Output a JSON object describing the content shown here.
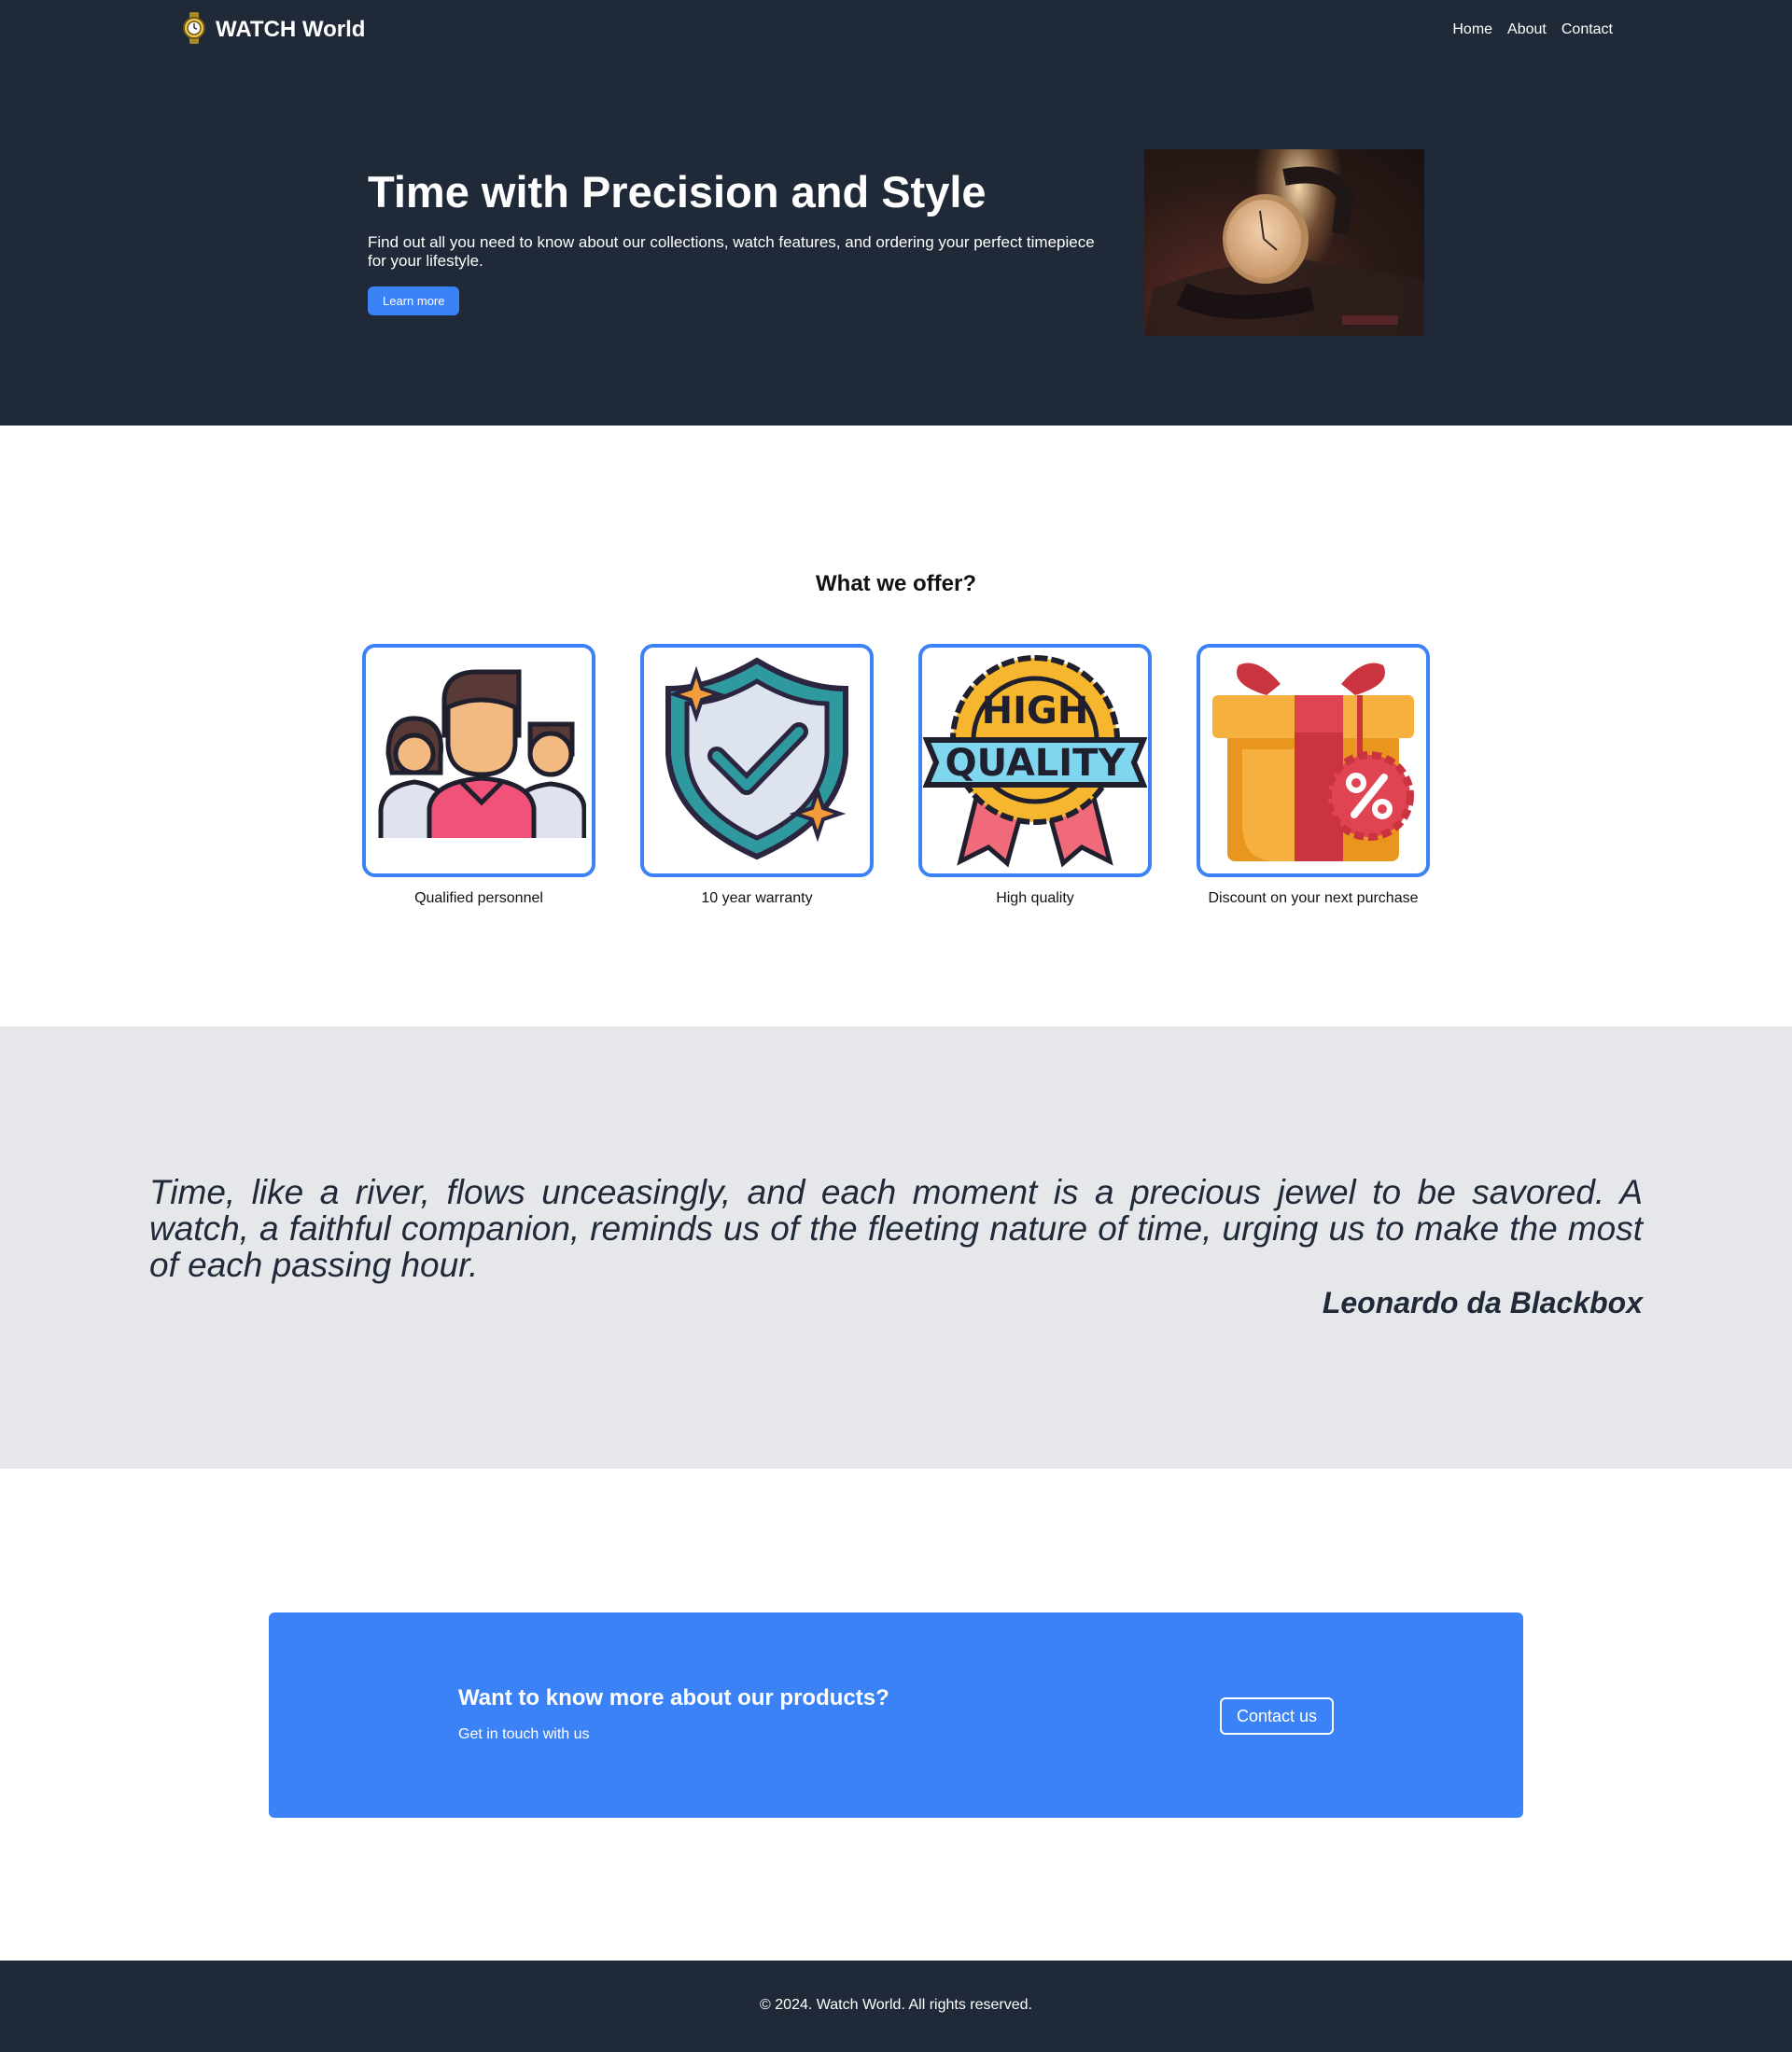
{
  "nav": {
    "brand": "WATCH World",
    "logo_icon": "watch-icon",
    "links": [
      "Home",
      "About",
      "Contact"
    ]
  },
  "hero": {
    "title": "Time with Precision and Style",
    "subtitle": "Find out all you need to know about our collections, watch features, and ordering your perfect timepiece for your lifestyle.",
    "button": "Learn more",
    "image_icon": "wristwatch-photo"
  },
  "offers": {
    "title": "What we offer?",
    "items": [
      {
        "label": "Qualified personnel",
        "icon": "team-icon"
      },
      {
        "label": "10 year warranty",
        "icon": "shield-check-icon"
      },
      {
        "label": "High quality",
        "icon": "high-quality-badge-icon"
      },
      {
        "label": "Discount on your next purchase",
        "icon": "gift-discount-icon"
      }
    ]
  },
  "quote": {
    "text": "Time, like a river, flows unceasingly, and each moment is a precious jewel to be savored. A watch, a faithful companion, reminds us of the fleeting nature of time, urging us to make the most of each passing hour.",
    "author": "Leonardo da Blackbox"
  },
  "cta": {
    "title": "Want to know more about our products?",
    "subtitle": "Get in touch with us",
    "button": "Contact us"
  },
  "footer": {
    "text": "© 2024. Watch World. All rights reserved."
  },
  "colors": {
    "dark": "#1f2937",
    "accent": "#3b82f6",
    "quote_bg": "#e5e7eb"
  }
}
